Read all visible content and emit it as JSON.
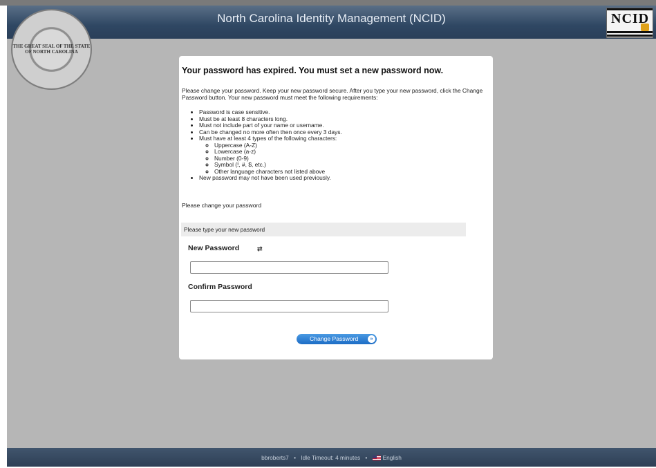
{
  "header": {
    "title": "North Carolina Identity Management (NCID)",
    "logo_text": "NCID",
    "seal_text": "THE GREAT SEAL OF THE STATE OF NORTH CAROLINA"
  },
  "card": {
    "heading": "Your password has expired. You must set a new password now.",
    "intro": "Please change your password. Keep your new password secure. After you type your new password, click the Change Password button. Your new password must meet the following requirements:",
    "requirements": [
      "Password is case sensitive.",
      "Must be at least 8 characters long.",
      "Must not include part of your name or username.",
      "Can be changed no more often then once every 3 days.",
      "Must have at least 4 types of the following characters:"
    ],
    "char_types": [
      "Uppercase (A-Z)",
      "Lowercase (a-z)",
      "Number (0-9)",
      "Symbol (!, #, $, etc.)",
      "Other language characters not listed above"
    ],
    "final_requirement": "New password may not have been used previously.",
    "change_label": "Please change your password",
    "section_title": "Please type your new password",
    "new_password_label": "New Password",
    "new_password_value": "",
    "confirm_password_label": "Confirm Password",
    "confirm_password_value": "",
    "button_label": "Change Password"
  },
  "icons": {
    "generate": "swap-arrows-icon",
    "button_arrow": "double-chevron-right-icon",
    "language_flag": "us-flag-icon"
  },
  "footer": {
    "username": "bbroberts7",
    "separator": "•",
    "idle_timeout": "Idle Timeout: 4 minutes",
    "language": "English"
  }
}
